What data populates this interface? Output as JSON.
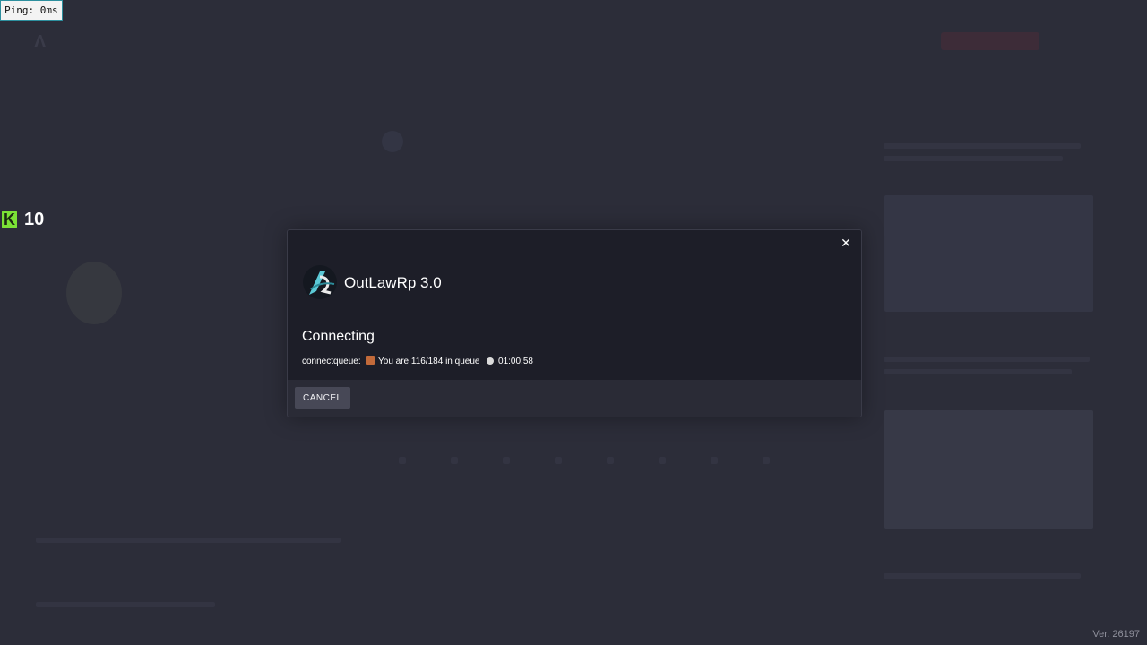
{
  "overlay": {
    "ping_text": "Ping: 0ms",
    "kills_icon": "K",
    "kills_value": "10",
    "version_text": "Ver. 26197"
  },
  "modal": {
    "server_name": "OutLawRp 3.0",
    "status_title": "Connecting",
    "queue_prefix": "connectqueue:",
    "queue_position": "You are 116/184 in queue",
    "queue_time": "01:00:58",
    "cancel_label": "CANCEL",
    "close_icon": "close-icon",
    "emoji_icon": "building-icon",
    "clock_icon": "clock-icon"
  },
  "colors": {
    "accent_kills": "#7be236",
    "modal_bg": "#1d1e28",
    "footer_bg": "#2a2b36",
    "cancel_bg": "#474856"
  }
}
